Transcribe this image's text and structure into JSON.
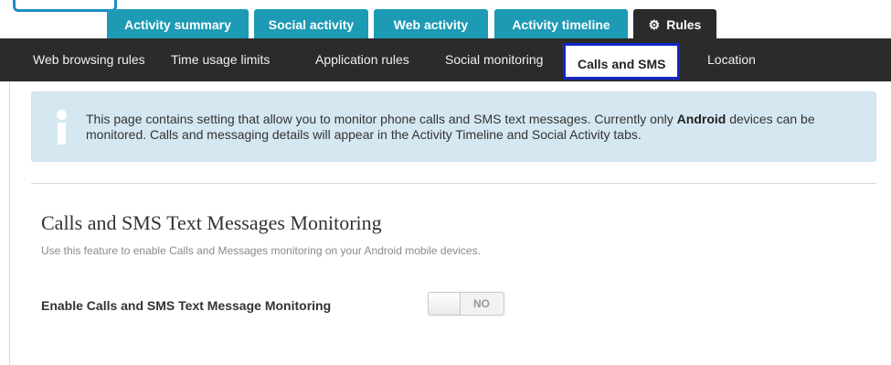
{
  "tabs": [
    {
      "label": "Activity summary"
    },
    {
      "label": "Social activity"
    },
    {
      "label": "Web activity"
    },
    {
      "label": "Activity timeline"
    },
    {
      "label": "Rules",
      "icon": "gear-icon",
      "active": true
    }
  ],
  "subnav": [
    {
      "label": "Web browsing rules"
    },
    {
      "label": "Time usage limits"
    },
    {
      "label": "Application rules"
    },
    {
      "label": "Social monitoring"
    },
    {
      "label": "Calls and SMS",
      "active": true
    },
    {
      "label": "Location"
    }
  ],
  "info": {
    "icon": "info-icon",
    "text_part1": "This page contains setting that allow you to monitor phone calls and SMS text messages. Currently only ",
    "text_bold": "Android",
    "text_part2": " devices can be monitored. Calls and messaging details will appear in the Activity Timeline and Social Activity tabs."
  },
  "section": {
    "title": "Calls and SMS Text Messages Monitoring",
    "description": "Use this feature to enable Calls and Messages monitoring on your Android mobile devices."
  },
  "setting": {
    "label": "Enable Calls and SMS Text Message Monitoring",
    "toggle_value": "NO"
  },
  "colors": {
    "tab_bg": "#1d9ab4",
    "nav_bg": "#2b2b2b",
    "active_outline": "#1227c9",
    "info_bg": "#d5e8f1"
  }
}
